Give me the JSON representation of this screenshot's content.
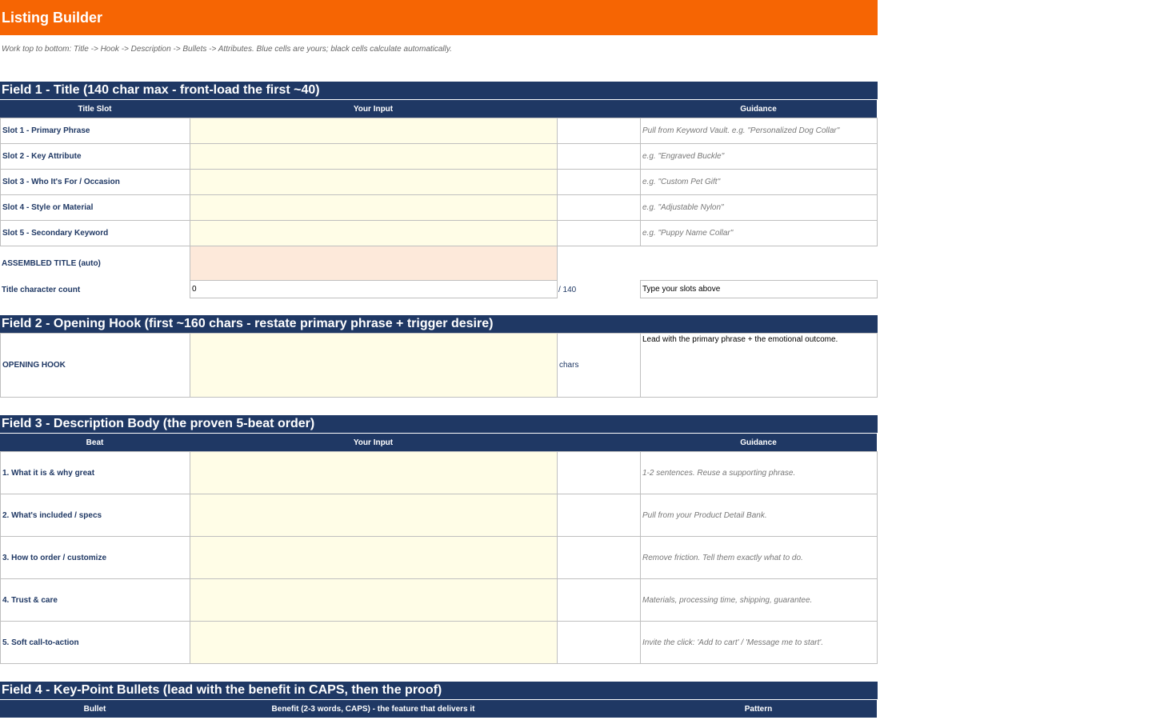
{
  "app": {
    "title": "Listing Builder",
    "instructions": "Work top to bottom: Title -> Hook -> Description -> Bullets -> Attributes. Blue cells are yours; black cells calculate automatically."
  },
  "colors": {
    "banner": "#f66503",
    "section_header": "#1f3864",
    "input_fill": "#fffde7",
    "auto_fill": "#fde9da"
  },
  "field1": {
    "title": "Field 1 - Title (140 char max - front-load the first ~40)",
    "headers": [
      "Title Slot",
      "Your Input",
      "",
      "Guidance"
    ],
    "rows": [
      {
        "label": "Slot 1 - Primary Phrase",
        "input": "",
        "guidance": "Pull from Keyword Vault. e.g. \"Personalized Dog Collar\""
      },
      {
        "label": "Slot 2 - Key Attribute",
        "input": "",
        "guidance": "e.g. \"Engraved Buckle\""
      },
      {
        "label": "Slot 3 - Who It's For / Occasion",
        "input": "",
        "guidance": "e.g. \"Custom Pet Gift\""
      },
      {
        "label": "Slot 4 - Style or Material",
        "input": "",
        "guidance": "e.g. \"Adjustable Nylon\""
      },
      {
        "label": "Slot 5 - Secondary Keyword",
        "input": "",
        "guidance": "e.g. \"Puppy Name Collar\""
      }
    ],
    "assembled_label": "ASSEMBLED TITLE (auto)",
    "assembled_value": "",
    "count_label": "Title character count",
    "count_value": "0",
    "count_max": "/ 140",
    "count_status": "Type your slots above"
  },
  "field2": {
    "title": "Field 2 - Opening Hook (first ~160 chars - restate primary phrase + trigger desire)",
    "label": "OPENING HOOK",
    "input": "",
    "chars_label": "chars",
    "guidance": "Lead with the primary phrase + the emotional outcome."
  },
  "field3": {
    "title": "Field 3 - Description Body (the proven 5-beat order)",
    "headers": [
      "Beat",
      "Your Input",
      "",
      "Guidance"
    ],
    "rows": [
      {
        "label": "1. What it is & why great",
        "input": "",
        "guidance": "1-2 sentences. Reuse a supporting phrase."
      },
      {
        "label": "2. What's included / specs",
        "input": "",
        "guidance": "Pull from your Product Detail Bank."
      },
      {
        "label": "3. How to order / customize",
        "input": "",
        "guidance": "Remove friction. Tell them exactly what to do."
      },
      {
        "label": "4. Trust & care",
        "input": "",
        "guidance": "Materials, processing time, shipping, guarantee."
      },
      {
        "label": "5. Soft call-to-action",
        "input": "",
        "guidance": "Invite the click: 'Add to cart' / 'Message me to start'."
      }
    ]
  },
  "field4": {
    "title": "Field 4 - Key-Point Bullets (lead with the benefit in CAPS, then the proof)",
    "headers": [
      "Bullet",
      "Benefit (2-3 words, CAPS) - the feature that delivers it",
      "",
      "Pattern"
    ]
  }
}
